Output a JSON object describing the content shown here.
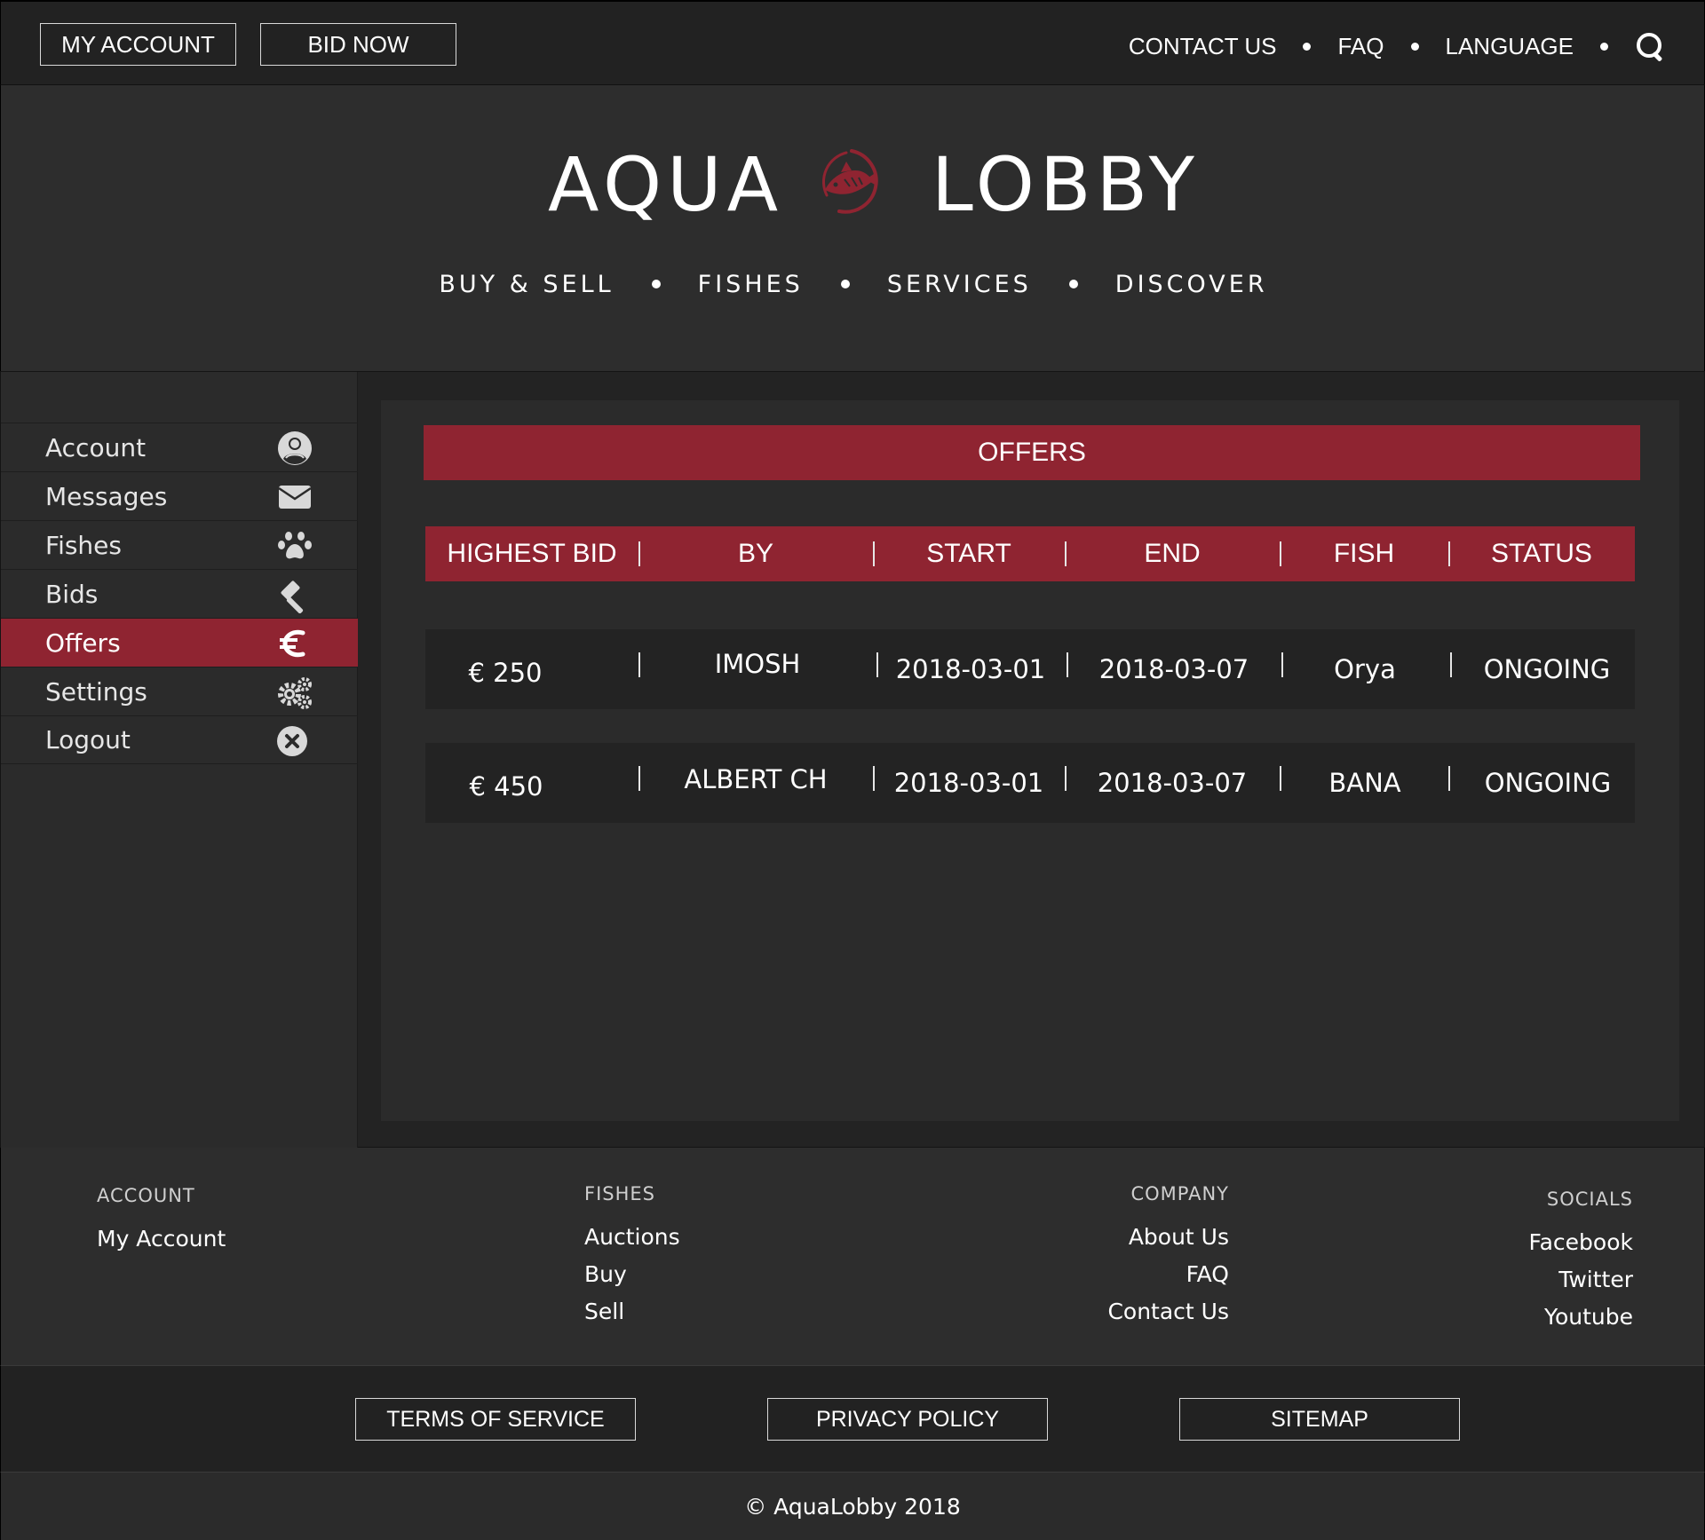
{
  "topbar": {
    "my_account": "MY ACCOUNT",
    "bid_now": "BID NOW",
    "links": [
      "CONTACT US",
      "FAQ",
      "LANGUAGE"
    ],
    "search_icon": "search-icon"
  },
  "brand": {
    "left": "AQUA",
    "right": "LOBBY",
    "mark_color": "#8f2431"
  },
  "main_nav": [
    "BUY & SELL",
    "FISHES",
    "SERVICES",
    "DISCOVER"
  ],
  "sidebar": {
    "items": [
      {
        "label": "Account",
        "icon": "user-circle-icon"
      },
      {
        "label": "Messages",
        "icon": "envelope-icon"
      },
      {
        "label": "Fishes",
        "icon": "paw-icon"
      },
      {
        "label": "Bids",
        "icon": "gavel-icon"
      },
      {
        "label": "Offers",
        "icon": "euro-icon",
        "active": true
      },
      {
        "label": "Settings",
        "icon": "gears-icon"
      },
      {
        "label": "Logout",
        "icon": "close-circle-icon"
      }
    ]
  },
  "offers": {
    "title": "OFFERS",
    "columns": [
      "HIGHEST BID",
      "BY",
      "START",
      "END",
      "FISH",
      "STATUS"
    ],
    "rows": [
      {
        "bid": "€ 250",
        "by": "IMOSH",
        "start": "2018-03-01",
        "end": "2018-03-07",
        "fish": "Orya",
        "status": "ONGOING"
      },
      {
        "bid": "€ 450",
        "by": "ALBERT CH",
        "start": "2018-03-01",
        "end": "2018-03-07",
        "fish": "BANA",
        "status": "ONGOING"
      }
    ]
  },
  "footer": {
    "account": {
      "heading": "ACCOUNT",
      "links": [
        "My Account"
      ]
    },
    "fishes": {
      "heading": "FISHES",
      "links": [
        "Auctions",
        "Buy",
        "Sell"
      ]
    },
    "company": {
      "heading": "COMPANY",
      "links": [
        "About Us",
        "FAQ",
        "Contact Us"
      ]
    },
    "socials": {
      "heading": "SOCIALS",
      "links": [
        "Facebook",
        "Twitter",
        "Youtube"
      ]
    }
  },
  "legal": {
    "terms": "TERMS OF SERVICE",
    "privacy": "PRIVACY POLICY",
    "sitemap": "SITEMAP"
  },
  "copyright": "© AquaLobby 2018",
  "colors": {
    "accent": "#8f2431",
    "background": "#2b2b2b",
    "dark": "#222222"
  }
}
